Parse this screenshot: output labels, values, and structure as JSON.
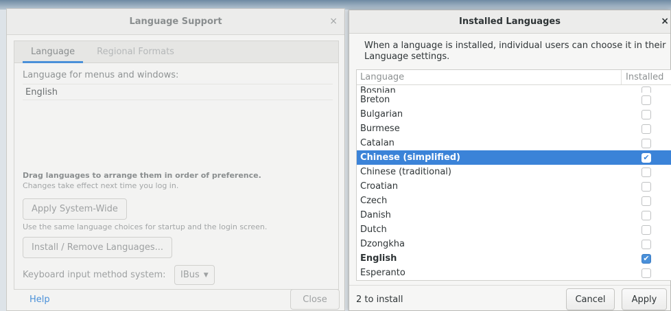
{
  "language_support": {
    "title": "Language Support",
    "close_glyph": "×",
    "tabs": [
      {
        "label": "Language"
      },
      {
        "label": "Regional Formats"
      }
    ],
    "menus_label": "Language for menus and windows:",
    "languages": [
      "English"
    ],
    "drag_hint_bold": "Drag languages to arrange them in order of preference.",
    "drag_hint_note": "Changes take effect next time you log in.",
    "apply_system_wide": "Apply System-Wide",
    "system_wide_note": "Use the same language choices for startup and the login screen.",
    "install_remove": "Install / Remove Languages...",
    "keyboard_label": "Keyboard input method system:",
    "keyboard_value": "IBus",
    "help": "Help",
    "close": "Close"
  },
  "installed_languages": {
    "title": "Installed Languages",
    "close_glyph": "×",
    "description": "When a language is installed, individual users can choose it in their Language settings.",
    "columns": {
      "language": "Language",
      "installed": "Installed"
    },
    "rows": [
      {
        "name": "Bosnian",
        "installed": false
      },
      {
        "name": "Breton",
        "installed": false
      },
      {
        "name": "Bulgarian",
        "installed": false
      },
      {
        "name": "Burmese",
        "installed": false
      },
      {
        "name": "Catalan",
        "installed": false
      },
      {
        "name": "Chinese (simplified)",
        "installed": true
      },
      {
        "name": "Chinese (traditional)",
        "installed": false
      },
      {
        "name": "Croatian",
        "installed": false
      },
      {
        "name": "Czech",
        "installed": false
      },
      {
        "name": "Danish",
        "installed": false
      },
      {
        "name": "Dutch",
        "installed": false
      },
      {
        "name": "Dzongkha",
        "installed": false
      },
      {
        "name": "English",
        "installed": true
      },
      {
        "name": "Esperanto",
        "installed": false
      }
    ],
    "status": "2 to install",
    "cancel": "Cancel",
    "apply": "Apply"
  },
  "colors": {
    "accent": "#4a90d9",
    "selection": "#3b83d8"
  }
}
